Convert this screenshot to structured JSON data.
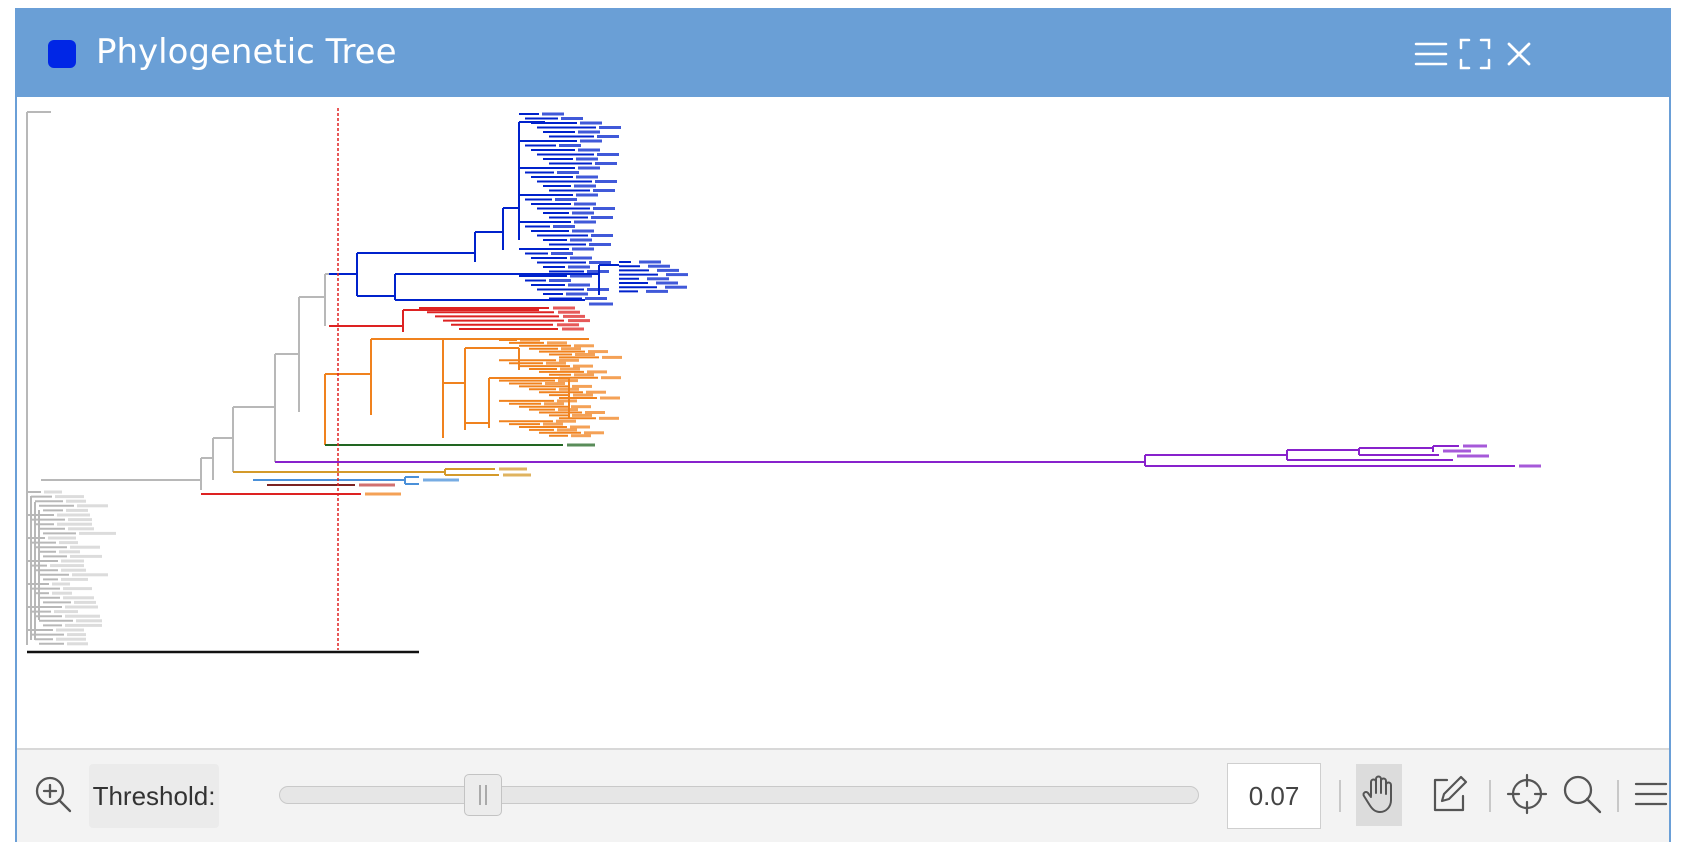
{
  "window": {
    "title": "Phylogenetic Tree",
    "title_color": "#0026e6",
    "titlebar_color": "#6a9fd6"
  },
  "titlebar_buttons": [
    "menu-icon",
    "fullscreen-icon",
    "close-icon"
  ],
  "tree": {
    "threshold_line_color": "#e02020",
    "clade_colors": {
      "blue": "#0022cc",
      "red": "#dd2222",
      "orange": "#f0821e",
      "green": "#226622",
      "purple": "#8822cc",
      "gray": "#b8b8b8",
      "light_blue": "#4a90d9",
      "gold": "#d49a2a"
    }
  },
  "toolbar": {
    "zoom_icon": "zoom-in-icon",
    "threshold_label": "Threshold:",
    "threshold_value": "0.07",
    "slider_fraction": 0.2,
    "tools": [
      "hand-pan-icon",
      "edit-icon",
      "crosshair-icon",
      "search-icon",
      "menu-icon"
    ]
  }
}
